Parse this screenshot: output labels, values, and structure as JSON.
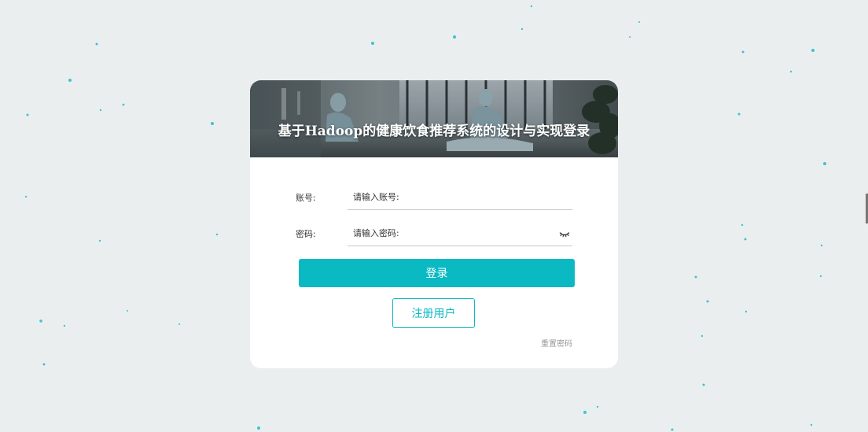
{
  "login": {
    "title": "基于Hadoop的健康饮食推荐系统的设计与实现登录",
    "account_label": "账号:",
    "account_placeholder": "请输入账号:",
    "password_label": "密码:",
    "password_placeholder": "请输入密码:",
    "login_button": "登录",
    "register_button": "注册用户",
    "reset_link": "重置密码"
  },
  "theme": {
    "accent": "#0bb9c3",
    "background": "#ebeeef",
    "card": "#ffffff",
    "dot_color": "#3cc4d0"
  },
  "icons": {
    "password_toggle": "eye-closed-icon"
  }
}
